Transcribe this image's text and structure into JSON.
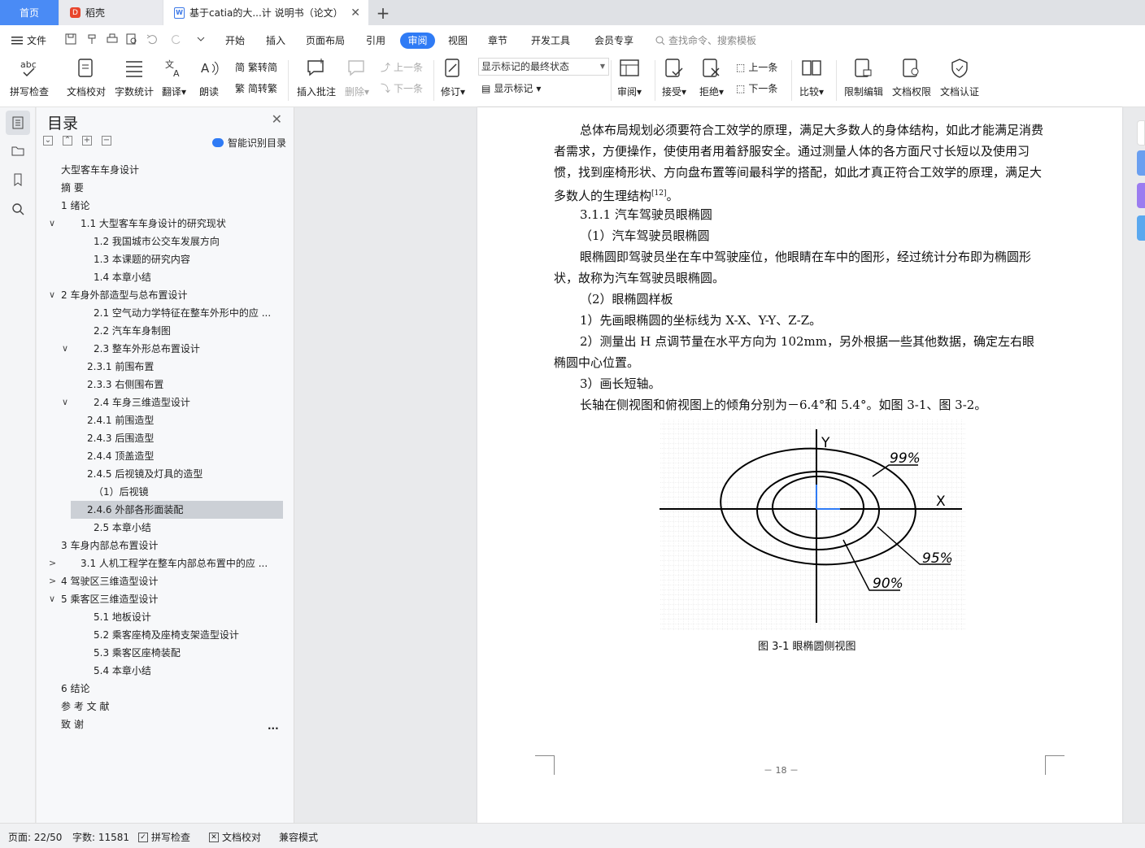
{
  "tabs": {
    "home": "首页",
    "daoke": "稻壳",
    "doc": "基于catia的大...计 说明书（论文）",
    "close_symbol": "✕",
    "add_symbol": "+"
  },
  "menu": {
    "file": "文件",
    "items": [
      "开始",
      "插入",
      "页面布局",
      "引用",
      "审阅",
      "视图",
      "章节",
      "开发工具",
      "会员专享"
    ],
    "active": "审阅",
    "search": "查找命令、搜索模板"
  },
  "ribbon": {
    "spell": "拼写检查",
    "proofread": "文档校对",
    "wordcount": "字数统计",
    "translate": "翻译",
    "read": "朗读",
    "trad": "繁转简",
    "simp": "简转繁",
    "insert_comment": "插入批注",
    "delete": "删除",
    "prev": "上一条",
    "next": "下一条",
    "revise": "修订",
    "show_mode": "显示标记的最终状态",
    "show_marks": "显示标记",
    "review": "审阅",
    "accept": "接受",
    "reject": "拒绝",
    "prev2": "上一条",
    "next2": "下一条",
    "compare": "比较",
    "restrict": "限制编辑",
    "rights": "文档权限",
    "certify": "文档认证"
  },
  "toc": {
    "title": "目录",
    "smart": "智能识别目录",
    "items": [
      {
        "label": "大型客车车身设计",
        "chev": ""
      },
      {
        "label": "摘    要",
        "chev": ""
      },
      {
        "label": "1   绪论",
        "chev": ""
      },
      {
        "label": "1.1   大型客车车身设计的研究现状",
        "chev": "∨"
      },
      {
        "label": "1.2   我国城市公交车发展方向",
        "chev": ""
      },
      {
        "label": "1.3   本课题的研究内容",
        "chev": ""
      },
      {
        "label": "1.4   本章小结",
        "chev": ""
      },
      {
        "label": "2   车身外部造型与总布置设计",
        "chev": "∨"
      },
      {
        "label": "2.1   空气动力学特征在整车外形中的应 ...",
        "chev": ""
      },
      {
        "label": "2.2   汽车车身制图",
        "chev": ""
      },
      {
        "label": "2.3   整车外形总布置设计",
        "chev": "∨"
      },
      {
        "label": "2.3.1 前围布置",
        "chev": ""
      },
      {
        "label": "2.3.3 右侧围布置",
        "chev": ""
      },
      {
        "label": "2.4   车身三维造型设计",
        "chev": "∨"
      },
      {
        "label": "2.4.1  前围造型",
        "chev": ""
      },
      {
        "label": "2.4.3  后围造型",
        "chev": ""
      },
      {
        "label": "2.4.4  顶盖造型",
        "chev": ""
      },
      {
        "label": "2.4.5  后视镜及灯具的造型",
        "chev": ""
      },
      {
        "label": "（1）后视镜",
        "chev": ""
      },
      {
        "label": "2.4.6  外部各形面装配",
        "chev": ""
      },
      {
        "label": "2.5   本章小结",
        "chev": ""
      },
      {
        "label": "3 车身内部总布置设计",
        "chev": ""
      },
      {
        "label": "3.1   人机工程学在整车内部总布置中的应 ...",
        "chev": ">"
      },
      {
        "label": "4   驾驶区三维造型设计",
        "chev": ">"
      },
      {
        "label": "5   乘客区三维造型设计",
        "chev": "∨"
      },
      {
        "label": "5.1 地板设计",
        "chev": ""
      },
      {
        "label": "5.2 乘客座椅及座椅支架造型设计",
        "chev": ""
      },
      {
        "label": "5.3 乘客区座椅装配",
        "chev": ""
      },
      {
        "label": "5.4 本章小结",
        "chev": ""
      },
      {
        "label": "6   结论",
        "chev": ""
      },
      {
        "label": "参 考 文 献",
        "chev": ""
      },
      {
        "label": "致      谢",
        "chev": ""
      }
    ],
    "more": "..."
  },
  "document": {
    "p1": "总体布局规划必须要符合工效学的原理，满足大多数人的身体结构，如此才能满足消费者需求，方便操作，使使用者用着舒服安全。通过测量人体的各方面尺寸长短以及使用习惯，找到座椅形状、方向盘布置等间最科学的搭配，如此才真正符合工效学的原理，满足大多数人的生理结构",
    "p1_ref": "[12]",
    "p1_end": "。",
    "h1": "3.1.1  汽车驾驶员眼椭圆",
    "h2": "（1）汽车驾驶员眼椭圆",
    "p2": "眼椭圆即驾驶员坐在车中驾驶座位，他眼睛在车中的图形，经过统计分布即为椭圆形状，故称为汽车驾驶员眼椭圆。",
    "h3": "（2）眼椭圆样板",
    "p3": "1）先画眼椭圆的坐标线为 X-X、Y-Y、Z-Z。",
    "p4": "2）测量出 H 点调节量在水平方向为 102mm，另外根据一些其他数据，确定左右眼椭圆中心位置。",
    "p5": "3）画长短轴。",
    "p6": "长轴在侧视图和俯视图上的倾角分别为－6.4°和 5.4°。如图 3-1、图 3-2。",
    "figure": {
      "y_label": "Y",
      "x_label": "X",
      "l99": "99%",
      "l95": "95%",
      "l90": "90%"
    },
    "caption": "图 3-1  眼椭圆侧视图",
    "page_number": "－ 18 －"
  },
  "status": {
    "page": "页面: 22/50",
    "words": "字数: 11581",
    "spell": "拼写检查",
    "proof": "文档校对",
    "compat": "兼容模式"
  }
}
